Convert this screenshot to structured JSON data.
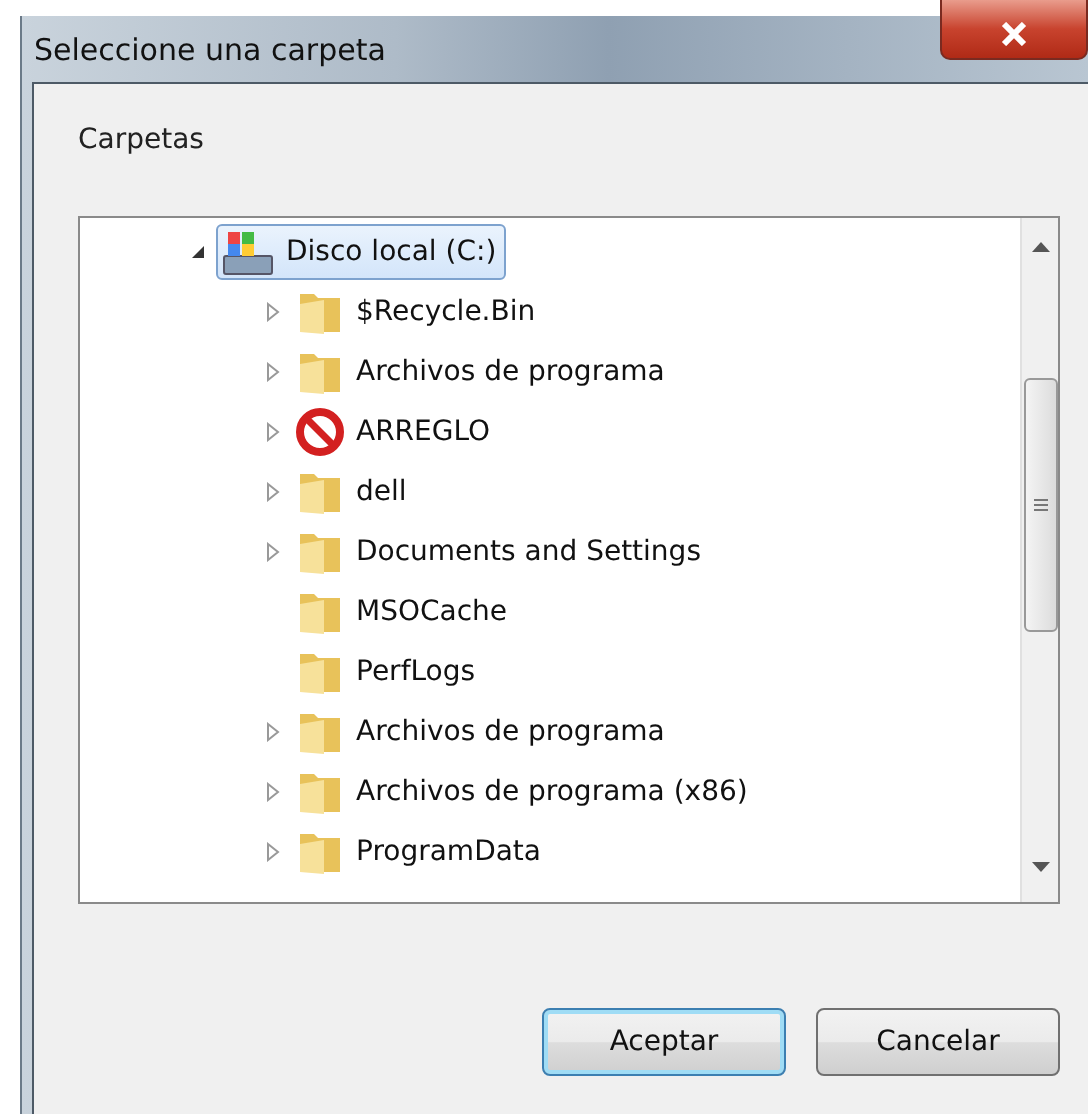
{
  "window": {
    "title": "Seleccione una carpeta"
  },
  "label": "Carpetas",
  "tree": [
    {
      "label": "Disco local (C:)",
      "kind": "drive",
      "selected": true,
      "expanded": true,
      "children": [
        {
          "label": "$Recycle.Bin",
          "kind": "folder",
          "expandable": true,
          "selected": false
        },
        {
          "label": "Archivos de programa",
          "kind": "folder",
          "expandable": true,
          "selected": false
        },
        {
          "label": "ARREGLO",
          "kind": "blocked",
          "expandable": true,
          "selected": false
        },
        {
          "label": "dell",
          "kind": "folder",
          "expandable": true,
          "selected": false
        },
        {
          "label": "Documents and Settings",
          "kind": "folder",
          "expandable": true,
          "selected": false
        },
        {
          "label": "MSOCache",
          "kind": "folder",
          "expandable": false,
          "selected": false
        },
        {
          "label": "PerfLogs",
          "kind": "folder",
          "expandable": false,
          "selected": false
        },
        {
          "label": "Archivos de programa",
          "kind": "folder",
          "expandable": true,
          "selected": false
        },
        {
          "label": "Archivos de programa (x86)",
          "kind": "folder",
          "expandable": true,
          "selected": false
        },
        {
          "label": "ProgramData",
          "kind": "folder",
          "expandable": true,
          "selected": false
        }
      ]
    }
  ],
  "buttons": [
    {
      "label": "Aceptar",
      "default": true
    },
    {
      "label": "Cancelar",
      "default": false
    }
  ]
}
